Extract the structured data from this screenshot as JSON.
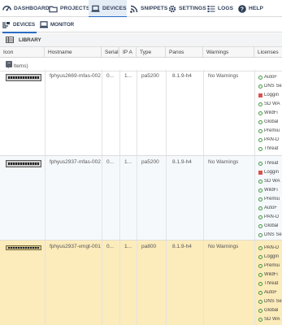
{
  "nav": {
    "items": [
      {
        "label": "DASHBOARD",
        "icon": "dashboard-icon",
        "active": false
      },
      {
        "label": "PROJECTS",
        "icon": "folder-icon",
        "active": false
      },
      {
        "label": "DEVICES",
        "icon": "laptop-icon",
        "active": true
      },
      {
        "label": "SNIPPETS",
        "icon": "rss-icon",
        "active": false
      },
      {
        "label": "SETTINGS",
        "icon": "gear-icon",
        "active": false
      },
      {
        "label": "LOGS",
        "icon": "list-icon",
        "active": false
      },
      {
        "label": "HELP",
        "icon": "help-icon",
        "active": false
      }
    ]
  },
  "subnav": {
    "items": [
      {
        "label": "DEVICES",
        "icon": "devices-icon",
        "active": true
      },
      {
        "label": "MONITOR",
        "icon": "monitor-icon",
        "active": false
      }
    ]
  },
  "library": {
    "label": "LIBRARY",
    "icon": "library-icon"
  },
  "grid": {
    "columns": [
      "Icon",
      "Hostname",
      "Serial",
      "IP A",
      "Type",
      "Panos",
      "Warnings",
      "Licenses"
    ],
    "group": {
      "label": "(3 Items)",
      "toggle": "−"
    },
    "rows": [
      {
        "hostname": "fphyus2669-mfas-002",
        "serial": "0...",
        "ip": "1...",
        "type": "pa5200",
        "panos": "8.1.9-h4",
        "warnings": "No Warnings",
        "licenses": [
          {
            "name": "AutoF",
            "status": "ok"
          },
          {
            "name": "DNS Se",
            "status": "ok"
          },
          {
            "name": "Loggin",
            "status": "error"
          },
          {
            "name": "SD WA",
            "status": "ok"
          },
          {
            "name": "WildFi",
            "status": "ok"
          },
          {
            "name": "Global",
            "status": "ok"
          },
          {
            "name": "Premiu",
            "status": "ok"
          },
          {
            "name": "PAN-D",
            "status": "ok"
          },
          {
            "name": "Threat",
            "status": "ok"
          }
        ]
      },
      {
        "hostname": "fphyus2937-mfas-002",
        "serial": "0...",
        "ip": "1...",
        "type": "pa5200",
        "panos": "8.1.9-h4",
        "warnings": "No Warnings",
        "licenses": [
          {
            "name": "Threat",
            "status": "ok"
          },
          {
            "name": "Loggin",
            "status": "error"
          },
          {
            "name": "SD WA",
            "status": "ok"
          },
          {
            "name": "WildFi",
            "status": "ok"
          },
          {
            "name": "Premiu",
            "status": "ok"
          },
          {
            "name": "AutoF",
            "status": "ok"
          },
          {
            "name": "PAN-D",
            "status": "ok"
          },
          {
            "name": "Global",
            "status": "ok"
          },
          {
            "name": "DNS Se",
            "status": "ok"
          }
        ]
      },
      {
        "hostname": "fphyus2937-vmgt-001",
        "serial": "0...",
        "ip": "1...",
        "type": "pa800",
        "panos": "8.1.9-h4",
        "warnings": "No Warnings",
        "licenses": [
          {
            "name": "PAN-D",
            "status": "ok"
          },
          {
            "name": "Loggin",
            "status": "ok"
          },
          {
            "name": "Premiu",
            "status": "ok"
          },
          {
            "name": "WildFi",
            "status": "ok"
          },
          {
            "name": "Threat",
            "status": "ok"
          },
          {
            "name": "AutoF",
            "status": "ok"
          },
          {
            "name": "DNS Se",
            "status": "ok"
          },
          {
            "name": "Global",
            "status": "ok"
          },
          {
            "name": "SD WA",
            "status": "ok"
          }
        ]
      }
    ]
  }
}
